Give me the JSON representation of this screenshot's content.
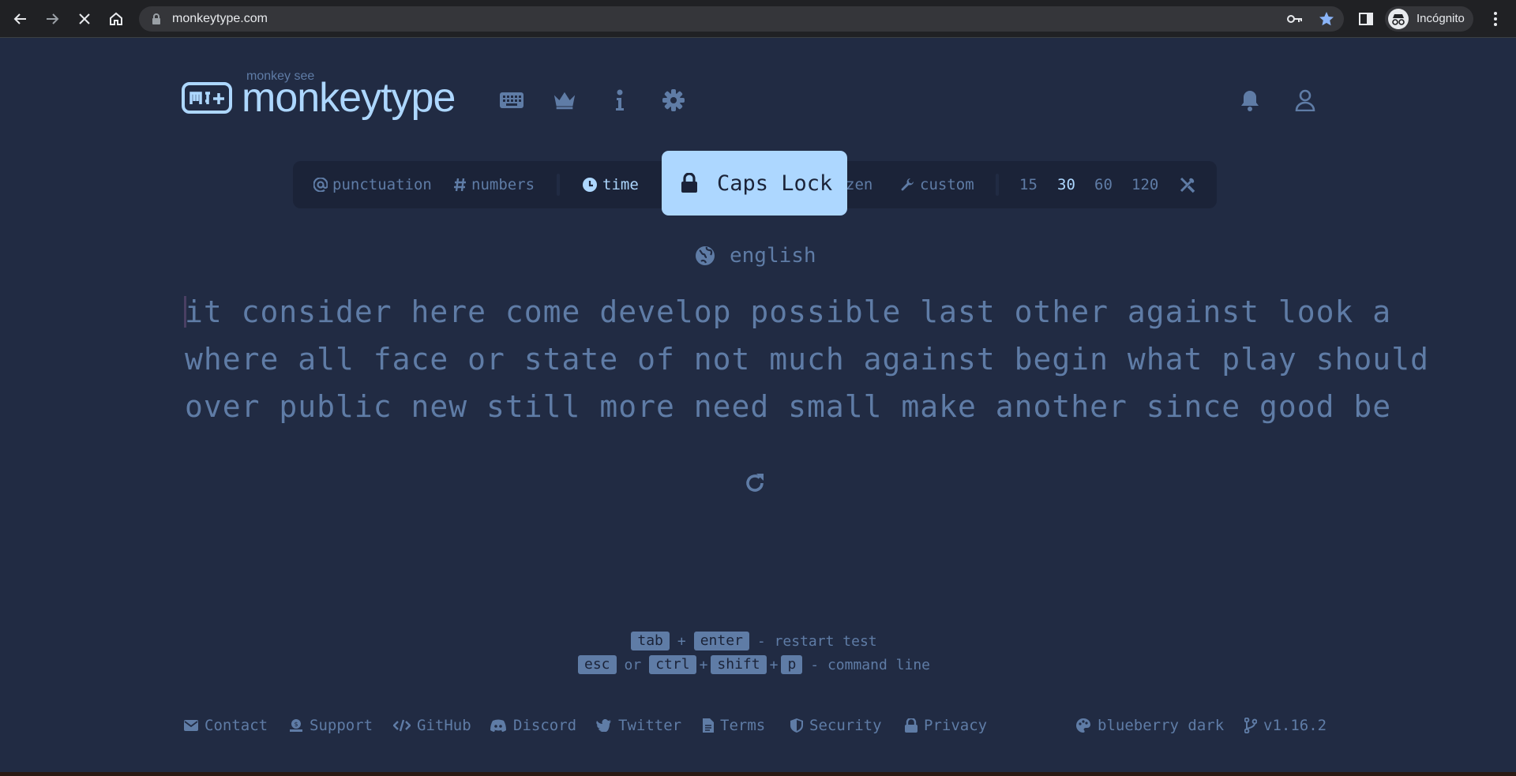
{
  "browser": {
    "url": "monkeytype.com",
    "profile_label": "Incógnito",
    "icons": [
      "back-icon",
      "forward-icon",
      "stop-icon",
      "home-icon",
      "lock-icon",
      "key-icon",
      "star-icon",
      "sidepanel-icon",
      "incognito-icon",
      "menu-icon"
    ]
  },
  "header": {
    "logo_sub": "monkey see",
    "logo_text": "monkeytype",
    "icons": [
      "keyboard-icon",
      "crown-icon",
      "info-icon",
      "gear-icon",
      "bell-icon",
      "user-icon"
    ]
  },
  "config": {
    "punctuation": "punctuation",
    "numbers": "numbers",
    "time": "time",
    "zen": "zen",
    "custom": "custom",
    "durations": [
      "15",
      "30",
      "60",
      "120"
    ],
    "active_duration": "30"
  },
  "caps_lock": {
    "label": "Caps Lock"
  },
  "language": "english",
  "words": {
    "lines": [
      "it consider here come develop possible last other against look a",
      "where all face or state of not much against begin what play should",
      "over public new still more need small make another since good be"
    ]
  },
  "shortcuts": {
    "row1": {
      "k1": "tab",
      "plus": "+",
      "k2": "enter",
      "desc": "- restart test"
    },
    "row2": {
      "k1": "esc",
      "or": "or",
      "k2": "ctrl",
      "plus1": "+",
      "k3": "shift",
      "plus2": "+",
      "k4": "p",
      "desc": "- command line"
    }
  },
  "footer": {
    "contact": "Contact",
    "support": "Support",
    "github": "GitHub",
    "discord": "Discord",
    "twitter": "Twitter",
    "terms": "Terms",
    "security": "Security",
    "privacy": "Privacy",
    "theme": "blueberry dark",
    "version": "v1.16.2"
  },
  "colors": {
    "bg": "#212b43",
    "sub": "#5f7ca6",
    "main": "#add7ff",
    "sub_alt": "#1b2338"
  }
}
